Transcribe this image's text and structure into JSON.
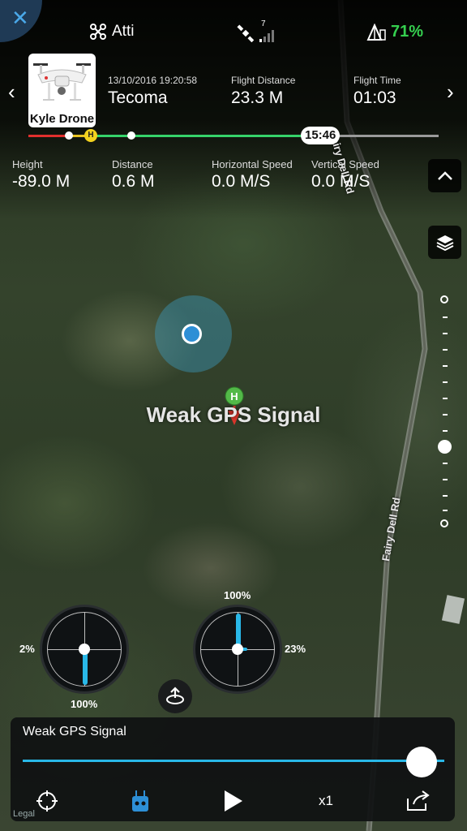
{
  "status_bar": {
    "flight_mode": "Atti",
    "satellite_count": "7",
    "battery_percent": "71%"
  },
  "flight_record": {
    "drone_name": "Kyle Drone",
    "datetime": "13/10/2016 19:20:58",
    "location": "Tecoma",
    "distance_label": "Flight Distance",
    "distance_value": "23.3 M",
    "time_label": "Flight Time",
    "time_value": "01:03",
    "playhead_time": "15:46",
    "home_marker": "H"
  },
  "telemetry": {
    "height_label": "Height",
    "height_value": "-89.0 M",
    "distance_label": "Distance",
    "distance_value": "0.6 M",
    "hspeed_label": "Horizontal Speed",
    "hspeed_value": "0.0 M/S",
    "vspeed_label": "Vertical Speed",
    "vspeed_value": "0.0 M/S"
  },
  "map": {
    "road_label_top": "Fairy Dell Rd",
    "road_label_bottom": "Fairy Dell Rd",
    "home_marker": "H",
    "warning": "Weak GPS Signal"
  },
  "sticks": {
    "left_horizontal_pct": "2%",
    "left_vertical_pct": "100%",
    "right_vertical_pct": "100%",
    "right_horizontal_pct": "23%"
  },
  "playback": {
    "message": "Weak GPS Signal",
    "progress": 0.97,
    "speed": "x1",
    "legal": "Legal"
  },
  "colors": {
    "accent_blue": "#29b8e8",
    "battery_green": "#35d04f",
    "home_yellow": "#f2d21e"
  },
  "icons": [
    "close-icon",
    "drone-icon",
    "satellite-icon",
    "signal-icon",
    "battery-icon",
    "chevron-left-icon",
    "chevron-right-icon",
    "chevron-up-icon",
    "layers-icon",
    "crosshair-icon",
    "remote-controller-icon",
    "play-icon",
    "share-icon",
    "flight-mode-icon"
  ]
}
